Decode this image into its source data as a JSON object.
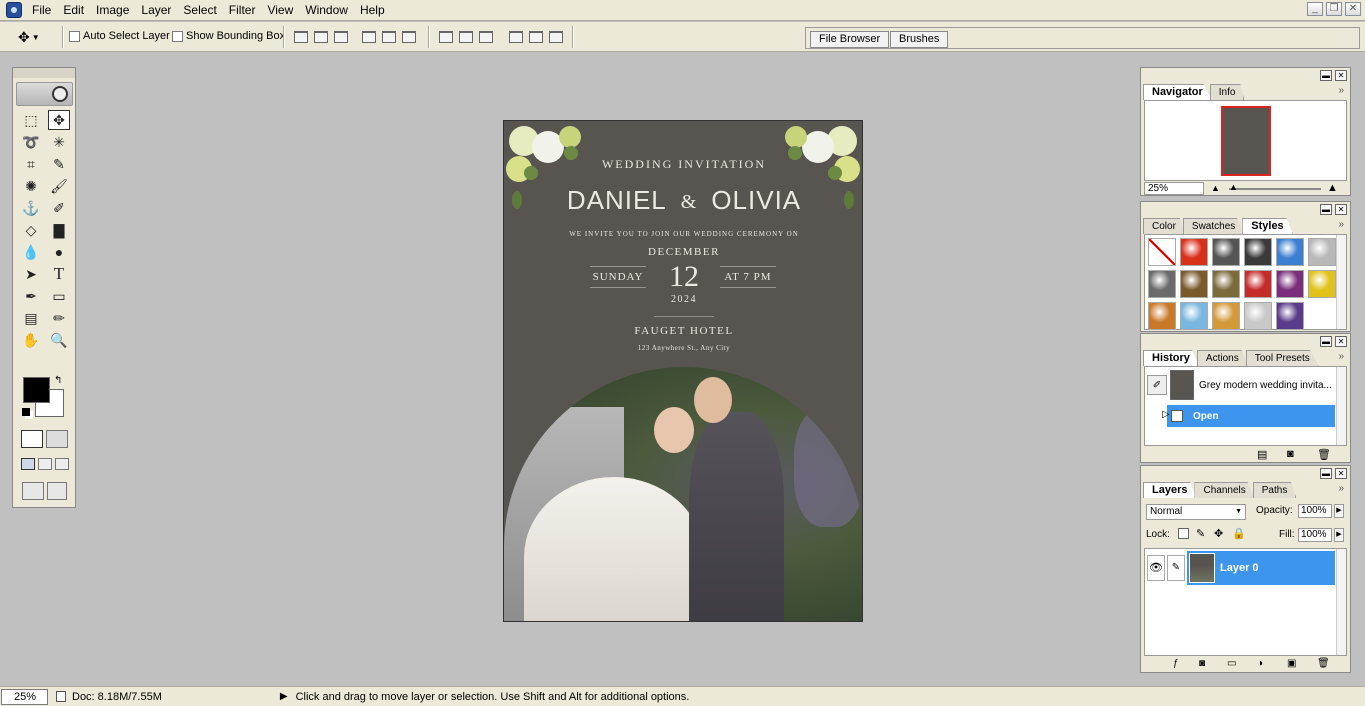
{
  "menubar": {
    "items": [
      "File",
      "Edit",
      "Image",
      "Layer",
      "Select",
      "Filter",
      "View",
      "Window",
      "Help"
    ]
  },
  "options": {
    "auto_select_label": "Auto Select Layer",
    "show_bbox_label": "Show Bounding Box"
  },
  "palette_well": {
    "tabs": [
      "File Browser",
      "Brushes"
    ]
  },
  "document": {
    "heading": "WEDDING INVITATION",
    "names_left": "DANIEL",
    "names_amp": "&",
    "names_right": "OLIVIA",
    "invite_line": "WE INVITE YOU TO JOIN OUR WEDDING CEREMONY ON",
    "month": "DECEMBER",
    "weekday": "SUNDAY",
    "day": "12",
    "time": "AT 7 PM",
    "year": "2024",
    "venue": "FAUGET HOTEL",
    "address": "123 Anywhere St., Any City",
    "background_color": "#585450"
  },
  "status": {
    "zoom": "25%",
    "doc_size": "Doc: 8.18M/7.55M",
    "hint": "Click and drag to move layer or selection.  Use Shift and Alt for additional options."
  },
  "navigator": {
    "tabs": [
      "Navigator",
      "Info"
    ],
    "zoom": "25%"
  },
  "styles_palette": {
    "tabs": [
      "Color",
      "Swatches",
      "Styles"
    ],
    "swatch_colors": [
      "#ffffff",
      "#d9301a",
      "#555555",
      "#3a3a3a",
      "#3b7fd0",
      "#b8b8b8",
      "#6b6b6b",
      "#7a5a2a",
      "#7b6a3a",
      "#c42b2b",
      "#7a2d7a",
      "#e0c21a",
      "#c87a2a",
      "#7ab7e0",
      "#d39a3a",
      "#c9c9c9",
      "#5a3a8a"
    ]
  },
  "history": {
    "tabs": [
      "History",
      "Actions",
      "Tool Presets"
    ],
    "snapshot_label": "Grey modern wedding invita...",
    "state_label": "Open"
  },
  "layers": {
    "tabs": [
      "Layers",
      "Channels",
      "Paths"
    ],
    "blend_mode": "Normal",
    "opacity_label": "Opacity:",
    "opacity_value": "100%",
    "lock_label": "Lock:",
    "fill_label": "Fill:",
    "fill_value": "100%",
    "layer_name": "Layer 0"
  },
  "colors": {
    "selection_blue": "#3d95ee",
    "chrome": "#ece9d8"
  }
}
